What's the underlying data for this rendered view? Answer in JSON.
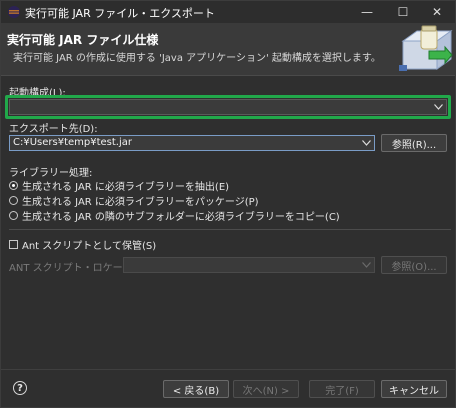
{
  "window": {
    "title": "実行可能 JAR ファイル・エクスポート",
    "minimize": "—",
    "maximize": "☐",
    "close": "✕"
  },
  "header": {
    "title": "実行可能 JAR ファイル仕様",
    "description": "実行可能 JAR の作成に使用する 'Java アプリケーション' 起動構成を選択します。"
  },
  "launch_config": {
    "label": "起動構成(L):",
    "value": ""
  },
  "export_dest": {
    "label": "エクスポート先(D):",
    "value": "C:¥Users¥temp¥test.jar",
    "browse_label": "参照(R)..."
  },
  "library_handling": {
    "label": "ライブラリー処理:",
    "options": [
      {
        "label": "生成される JAR に必須ライブラリーを抽出(E)",
        "checked": true
      },
      {
        "label": "生成される JAR に必須ライブラリーをパッケージ(P)",
        "checked": false
      },
      {
        "label": "生成される JAR の隣のサブフォルダーに必須ライブラリーをコピー(C)",
        "checked": false
      }
    ]
  },
  "ant_script": {
    "checkbox_label": "Ant スクリプトとして保管(S)",
    "checked": false,
    "location_label": "ANT スクリプト・ロケーション(A):",
    "location_value": "",
    "browse_label": "参照(O)..."
  },
  "footer": {
    "help": "?",
    "back_label": "< 戻る(B)",
    "next_label": "次へ(N) >",
    "finish_label": "完了(F)",
    "cancel_label": "キャンセル"
  },
  "colors": {
    "highlight": "#21a84a",
    "background": "#2f2f2f"
  }
}
